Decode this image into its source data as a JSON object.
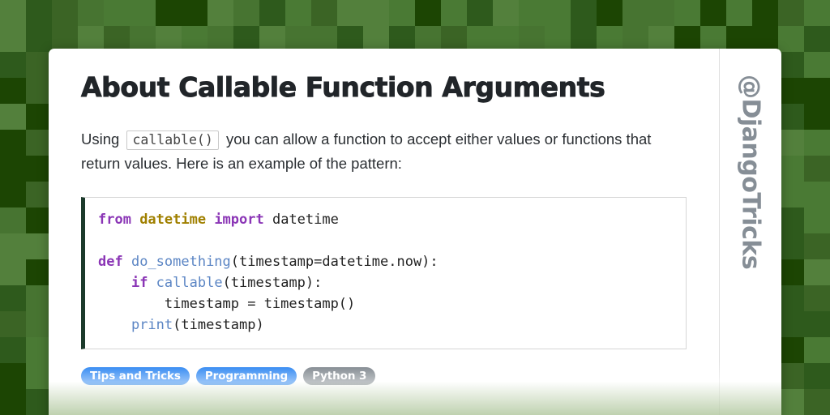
{
  "background": {
    "tile_size": 32,
    "palette": [
      "#477431",
      "#53803c",
      "#1c4503",
      "#3b6425",
      "#2e5a1c",
      "#4a7a34"
    ]
  },
  "card": {
    "title": "About Callable Function Arguments",
    "intro": {
      "before": "Using",
      "code": "callable()",
      "after": "you can allow a function to accept either values or functions that return values. Here is an example of the pattern:"
    },
    "code_block": {
      "language": "python",
      "accent_color": "#1b3a2b",
      "lines": [
        [
          {
            "t": "from ",
            "c": "tok-kw"
          },
          {
            "t": "datetime ",
            "c": "tok-mod"
          },
          {
            "t": "import ",
            "c": "tok-kw"
          },
          {
            "t": "datetime",
            "c": "tok-txt"
          }
        ],
        [],
        [
          {
            "t": "def ",
            "c": "tok-kw"
          },
          {
            "t": "do_something",
            "c": "tok-fn"
          },
          {
            "t": "(timestamp=datetime.now):",
            "c": "tok-txt"
          }
        ],
        [
          {
            "t": "    ",
            "c": "tok-txt"
          },
          {
            "t": "if ",
            "c": "tok-kw"
          },
          {
            "t": "callable",
            "c": "tok-bi"
          },
          {
            "t": "(timestamp):",
            "c": "tok-txt"
          }
        ],
        [
          {
            "t": "        timestamp = timestamp()",
            "c": "tok-txt"
          }
        ],
        [
          {
            "t": "    ",
            "c": "tok-txt"
          },
          {
            "t": "print",
            "c": "tok-bi"
          },
          {
            "t": "(timestamp)",
            "c": "tok-txt"
          }
        ]
      ],
      "plain_text": "from datetime import datetime\n\ndef do_something(timestamp=datetime.now):\n    if callable(timestamp):\n        timestamp = timestamp()\n    print(timestamp)"
    },
    "tags": [
      {
        "label": "Tips and Tricks",
        "style": "blue"
      },
      {
        "label": "Programming",
        "style": "blue"
      },
      {
        "label": "Python 3",
        "style": "gray"
      }
    ]
  },
  "rail": {
    "handle": "@DjangoTricks"
  },
  "colors": {
    "tag_blue": "#0d74f0",
    "tag_gray": "#6c757d",
    "title": "#212529",
    "code_accent": "#1b3a2b"
  }
}
